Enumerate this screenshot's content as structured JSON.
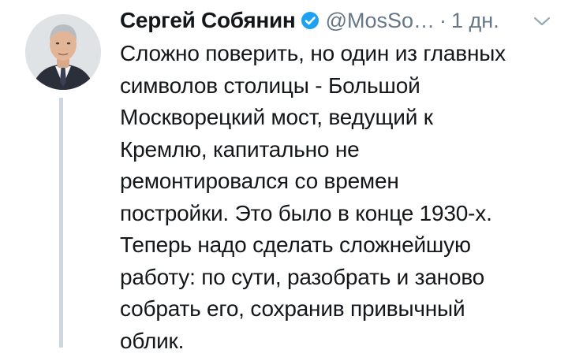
{
  "tweet": {
    "author": {
      "name": "Сергей Собянин",
      "handle": "@MosSo…",
      "verified": true,
      "avatar_icon": "user-avatar-portrait"
    },
    "separator": "·",
    "timestamp": "1 дн.",
    "menu_icon": "chevron-down-icon",
    "text_lines": [
      "Сложно поверить, но один из главных",
      "символов столицы - Большой",
      "Москворецкий мост, ведущий к",
      "Кремлю, капитально не",
      "ремонтировался со времен",
      "постройки. Это было в конце 1930-х.",
      "Теперь надо сделать сложнейшую",
      "работу: по сути, разобрать и заново",
      "собрать его, сохранив привычный",
      "облик."
    ]
  },
  "colors": {
    "text": "#14171a",
    "muted": "#657786",
    "verified": "#1da1f2",
    "thread_line": "#cfd6dc"
  }
}
